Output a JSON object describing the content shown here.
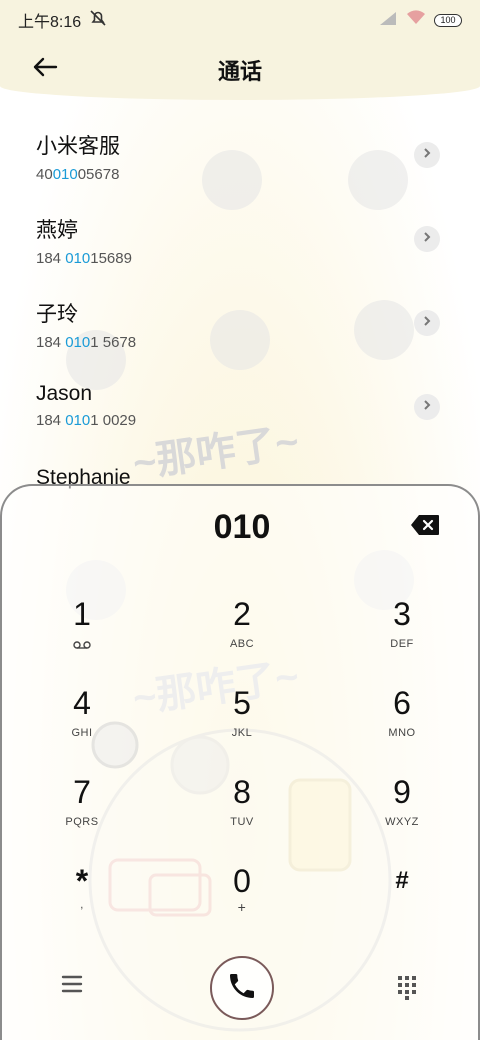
{
  "status_bar": {
    "time": "上午8:16",
    "battery": "100"
  },
  "header": {
    "title": "通话"
  },
  "contacts": [
    {
      "name": "小米客服",
      "number_pre": "40",
      "number_match": "010",
      "number_post": "05678"
    },
    {
      "name": "燕婷",
      "number_pre": "184 ",
      "number_match": "010",
      "number_post": "15689"
    },
    {
      "name": "子玲",
      "number_pre": "184 ",
      "number_match": "010",
      "number_post": "1 5678"
    },
    {
      "name": "Jason",
      "number_pre": "184 ",
      "number_match": "010",
      "number_post": "1 0029"
    },
    {
      "name": "Stephanie",
      "number_pre": "",
      "number_match": "",
      "number_post": ""
    }
  ],
  "dialpad": {
    "entered_number": "010",
    "keys": [
      {
        "digit": "1",
        "letters": ""
      },
      {
        "digit": "2",
        "letters": "ABC"
      },
      {
        "digit": "3",
        "letters": "DEF"
      },
      {
        "digit": "4",
        "letters": "GHI"
      },
      {
        "digit": "5",
        "letters": "JKL"
      },
      {
        "digit": "6",
        "letters": "MNO"
      },
      {
        "digit": "7",
        "letters": "PQRS"
      },
      {
        "digit": "8",
        "letters": "TUV"
      },
      {
        "digit": "9",
        "letters": "WXYZ"
      },
      {
        "digit": "*",
        "letters": ","
      },
      {
        "digit": "0",
        "letters": "+"
      },
      {
        "digit": "#",
        "letters": ""
      }
    ]
  },
  "icons": {
    "back": "arrow-left-icon",
    "mute": "bell-slash-icon",
    "signal": "signal-icon",
    "wifi": "wifi-icon",
    "backspace": "backspace-icon",
    "voicemail": "voicemail-icon",
    "menu": "menu-icon",
    "call": "phone-icon",
    "keypad": "keypad-icon"
  },
  "colors": {
    "highlight": "#1a9bd7",
    "header_bg": "#f7f3df"
  },
  "wallpaper_text": "~那咋了~"
}
